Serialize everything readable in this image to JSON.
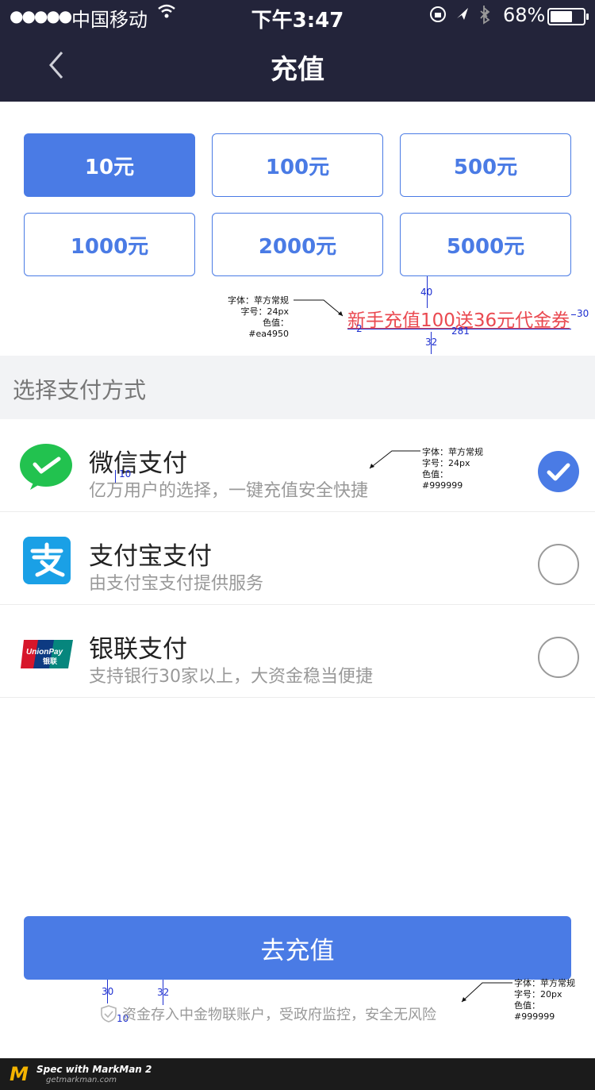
{
  "status_bar": {
    "signal": "●●●●●",
    "carrier": "中国移动",
    "time": "下午3:47",
    "battery": "68%",
    "battery_level": 0.68
  },
  "nav": {
    "title": "充值",
    "back_icon": "chevron-left-icon"
  },
  "amounts": [
    {
      "label": "10元",
      "selected": true
    },
    {
      "label": "100元",
      "selected": false
    },
    {
      "label": "500元",
      "selected": false
    },
    {
      "label": "1000元",
      "selected": false
    },
    {
      "label": "2000元",
      "selected": false
    },
    {
      "label": "5000元",
      "selected": false
    }
  ],
  "promo": {
    "text": "新手充值100送36元代金券",
    "color": "#ea4950"
  },
  "spec_promo": [
    "字体：苹方常规",
    "字号：24px",
    "色值：",
    "#ea4950"
  ],
  "spec_desc": [
    "字体：苹方常规",
    "字号：24px",
    "色值：",
    "#999999"
  ],
  "spec_footer": [
    "字体：苹方常规",
    "字号：20px",
    "色值：",
    "#999999"
  ],
  "dims": {
    "d40": "40",
    "d30": "30",
    "d2": "2",
    "d281": "281",
    "d32": "32",
    "d10": "10",
    "f30": "30",
    "f32": "32",
    "f10": "10"
  },
  "section_title": "选择支付方式",
  "payments": [
    {
      "name": "微信支付",
      "desc": "亿万用户的选择，一键充值安全快捷",
      "checked": true,
      "icon": "wechat-pay-icon"
    },
    {
      "name": "支付宝支付",
      "desc": "由支付宝支付提供服务",
      "checked": false,
      "icon": "alipay-icon"
    },
    {
      "name": "银联支付",
      "desc": "支持银行30家以上，大资金稳当便捷",
      "checked": false,
      "icon": "unionpay-icon"
    }
  ],
  "unionpay_logo": "UnionPay 银联",
  "submit_label": "去充值",
  "footer_note": "资金存入中金物联账户，受政府监控，安全无风险",
  "colors": {
    "accent": "#4a7be5",
    "nav_bg": "#23243a",
    "promo": "#ea4950",
    "muted": "#999999"
  },
  "watermark": {
    "brand": "Spec with MarkMan 2",
    "url": "getmarkman.com"
  }
}
